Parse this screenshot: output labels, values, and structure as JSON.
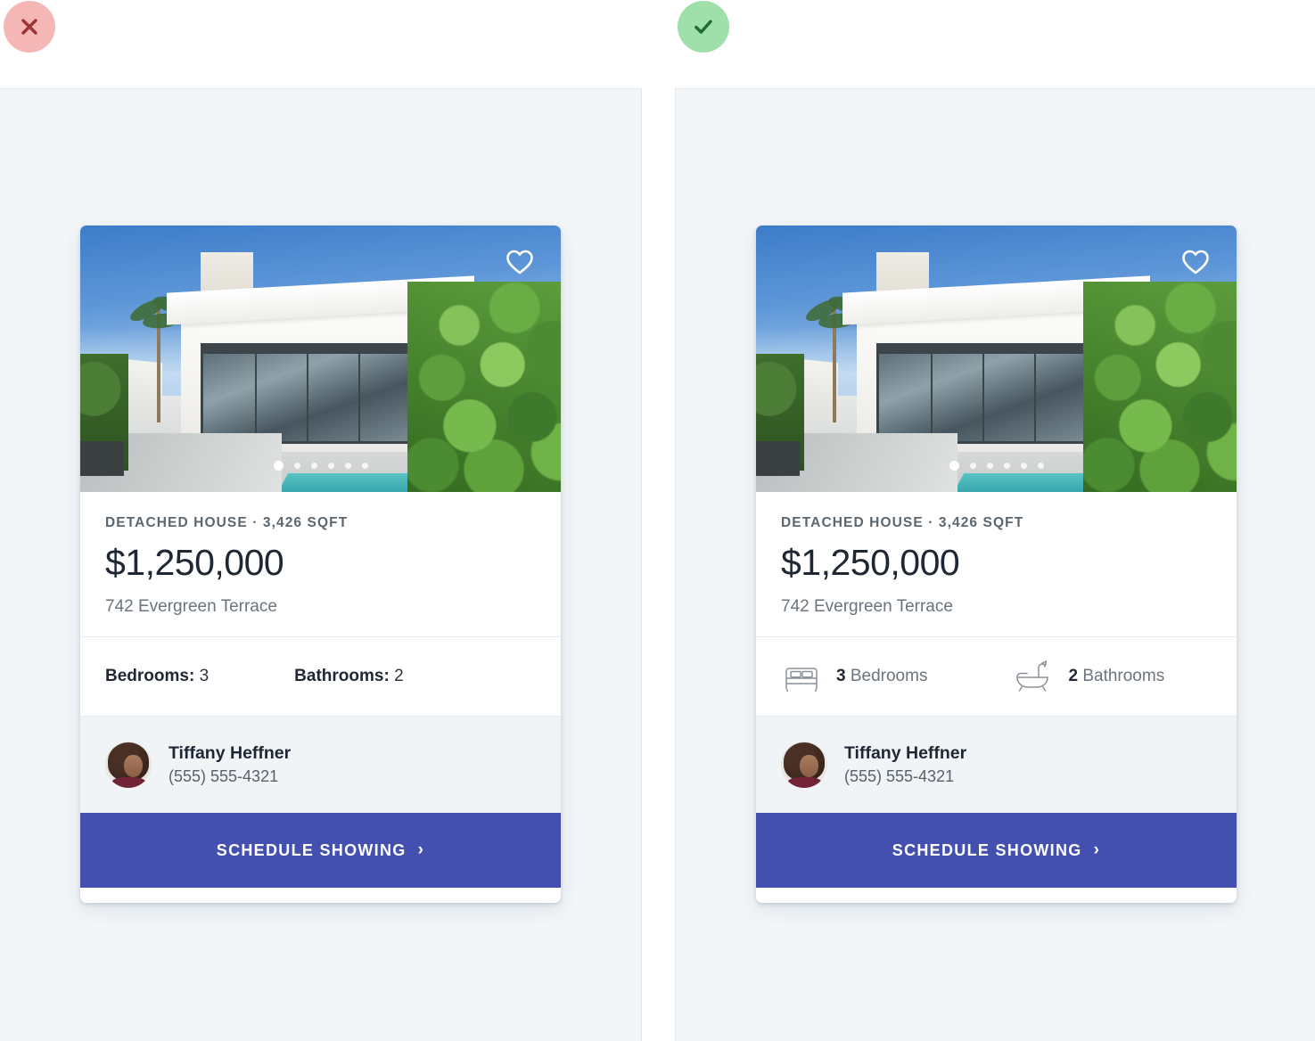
{
  "comparison": {
    "bad_badge": {
      "icon": "close-icon",
      "color": "#f5b6b6",
      "glyph_color": "#9c3232"
    },
    "good_badge": {
      "icon": "check-icon",
      "color": "#9fdfaa",
      "glyph_color": "#1f6b33"
    }
  },
  "theme": {
    "accent": "#4450b0",
    "panel_bg": "#f2f6f9",
    "card_bg": "#ffffff",
    "agent_bg": "#f0f4f7",
    "text_dark": "#1f2733",
    "text_muted": "#6b747c"
  },
  "card": {
    "photo": {
      "alt": "modern white detached house with pool and palm trees",
      "favorite_icon": "heart-icon",
      "carousel": {
        "total": 6,
        "active_index": 0
      }
    },
    "meta": "DETACHED HOUSE · 3,426 SQFT",
    "price": "$1,250,000",
    "address": "742 Evergreen Terrace",
    "specs_basic": {
      "bedrooms_label": "Bedrooms:",
      "bedrooms_value": "3",
      "bathrooms_label": "Bathrooms:",
      "bathrooms_value": "2"
    },
    "specs_rich": {
      "bedrooms_icon": "bed-icon",
      "bedrooms_count": "3",
      "bedrooms_label": "Bedrooms",
      "bathrooms_icon": "bathtub-icon",
      "bathrooms_count": "2",
      "bathrooms_label": "Bathrooms"
    },
    "agent": {
      "avatar_icon": "avatar",
      "name": "Tiffany Heffner",
      "phone": "(555) 555-4321"
    },
    "cta": {
      "label": "SCHEDULE SHOWING",
      "chevron": "›"
    }
  }
}
